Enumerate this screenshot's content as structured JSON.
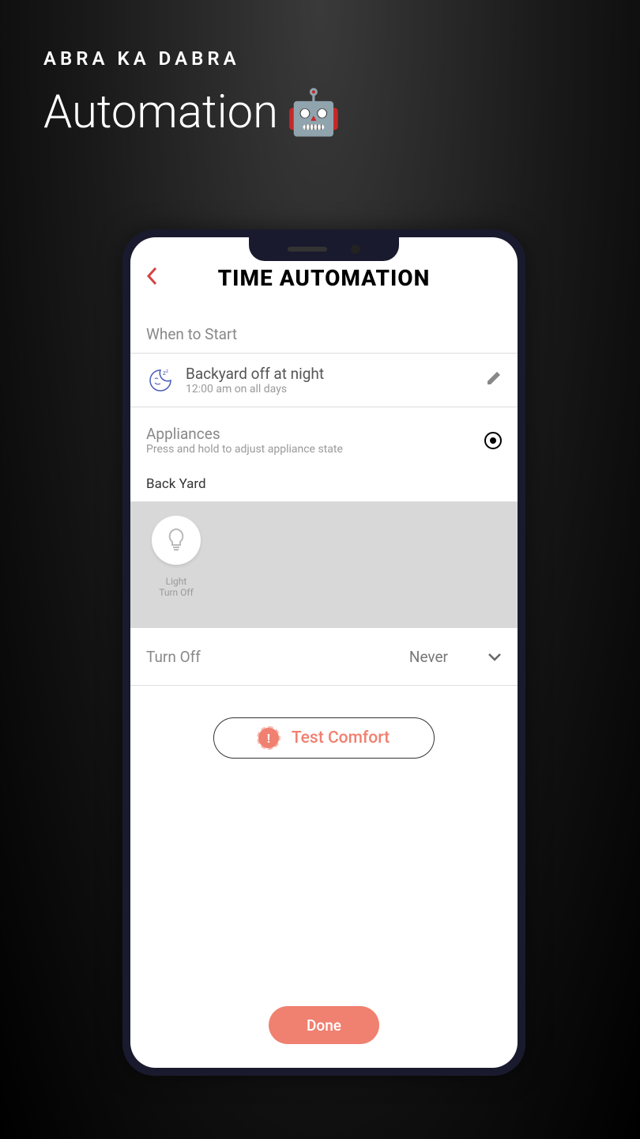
{
  "promo": {
    "brand": "ABRA KA DABRA",
    "title": "Automation",
    "emoji": "🤖"
  },
  "app": {
    "header_title": "TIME AUTOMATION"
  },
  "when_to_start": {
    "label": "When to Start",
    "schedule_title": "Backyard off at night",
    "schedule_subtitle": "12:00 am on all days"
  },
  "appliances": {
    "title": "Appliances",
    "subtitle": "Press and hold to adjust appliance state",
    "area": "Back Yard",
    "items": [
      {
        "name": "Light",
        "state": "Turn Off"
      }
    ]
  },
  "turnoff": {
    "label": "Turn Off",
    "value": "Never"
  },
  "test_button": "Test Comfort",
  "done_button": "Done"
}
